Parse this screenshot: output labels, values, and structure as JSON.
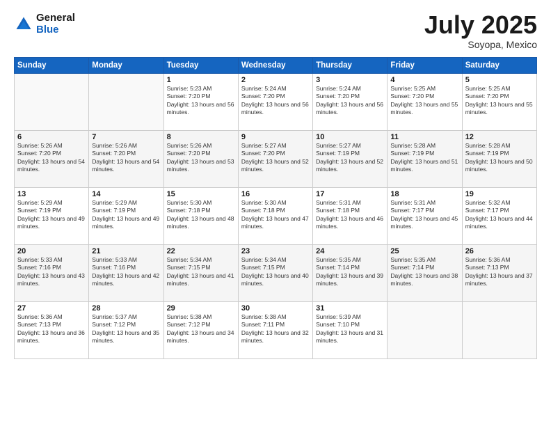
{
  "header": {
    "logo_general": "General",
    "logo_blue": "Blue",
    "month": "July 2025",
    "location": "Soyopa, Mexico"
  },
  "weekdays": [
    "Sunday",
    "Monday",
    "Tuesday",
    "Wednesday",
    "Thursday",
    "Friday",
    "Saturday"
  ],
  "weeks": [
    [
      {
        "day": "",
        "info": ""
      },
      {
        "day": "",
        "info": ""
      },
      {
        "day": "1",
        "info": "Sunrise: 5:23 AM\nSunset: 7:20 PM\nDaylight: 13 hours and 56 minutes."
      },
      {
        "day": "2",
        "info": "Sunrise: 5:24 AM\nSunset: 7:20 PM\nDaylight: 13 hours and 56 minutes."
      },
      {
        "day": "3",
        "info": "Sunrise: 5:24 AM\nSunset: 7:20 PM\nDaylight: 13 hours and 56 minutes."
      },
      {
        "day": "4",
        "info": "Sunrise: 5:25 AM\nSunset: 7:20 PM\nDaylight: 13 hours and 55 minutes."
      },
      {
        "day": "5",
        "info": "Sunrise: 5:25 AM\nSunset: 7:20 PM\nDaylight: 13 hours and 55 minutes."
      }
    ],
    [
      {
        "day": "6",
        "info": "Sunrise: 5:26 AM\nSunset: 7:20 PM\nDaylight: 13 hours and 54 minutes."
      },
      {
        "day": "7",
        "info": "Sunrise: 5:26 AM\nSunset: 7:20 PM\nDaylight: 13 hours and 54 minutes."
      },
      {
        "day": "8",
        "info": "Sunrise: 5:26 AM\nSunset: 7:20 PM\nDaylight: 13 hours and 53 minutes."
      },
      {
        "day": "9",
        "info": "Sunrise: 5:27 AM\nSunset: 7:20 PM\nDaylight: 13 hours and 52 minutes."
      },
      {
        "day": "10",
        "info": "Sunrise: 5:27 AM\nSunset: 7:19 PM\nDaylight: 13 hours and 52 minutes."
      },
      {
        "day": "11",
        "info": "Sunrise: 5:28 AM\nSunset: 7:19 PM\nDaylight: 13 hours and 51 minutes."
      },
      {
        "day": "12",
        "info": "Sunrise: 5:28 AM\nSunset: 7:19 PM\nDaylight: 13 hours and 50 minutes."
      }
    ],
    [
      {
        "day": "13",
        "info": "Sunrise: 5:29 AM\nSunset: 7:19 PM\nDaylight: 13 hours and 49 minutes."
      },
      {
        "day": "14",
        "info": "Sunrise: 5:29 AM\nSunset: 7:19 PM\nDaylight: 13 hours and 49 minutes."
      },
      {
        "day": "15",
        "info": "Sunrise: 5:30 AM\nSunset: 7:18 PM\nDaylight: 13 hours and 48 minutes."
      },
      {
        "day": "16",
        "info": "Sunrise: 5:30 AM\nSunset: 7:18 PM\nDaylight: 13 hours and 47 minutes."
      },
      {
        "day": "17",
        "info": "Sunrise: 5:31 AM\nSunset: 7:18 PM\nDaylight: 13 hours and 46 minutes."
      },
      {
        "day": "18",
        "info": "Sunrise: 5:31 AM\nSunset: 7:17 PM\nDaylight: 13 hours and 45 minutes."
      },
      {
        "day": "19",
        "info": "Sunrise: 5:32 AM\nSunset: 7:17 PM\nDaylight: 13 hours and 44 minutes."
      }
    ],
    [
      {
        "day": "20",
        "info": "Sunrise: 5:33 AM\nSunset: 7:16 PM\nDaylight: 13 hours and 43 minutes."
      },
      {
        "day": "21",
        "info": "Sunrise: 5:33 AM\nSunset: 7:16 PM\nDaylight: 13 hours and 42 minutes."
      },
      {
        "day": "22",
        "info": "Sunrise: 5:34 AM\nSunset: 7:15 PM\nDaylight: 13 hours and 41 minutes."
      },
      {
        "day": "23",
        "info": "Sunrise: 5:34 AM\nSunset: 7:15 PM\nDaylight: 13 hours and 40 minutes."
      },
      {
        "day": "24",
        "info": "Sunrise: 5:35 AM\nSunset: 7:14 PM\nDaylight: 13 hours and 39 minutes."
      },
      {
        "day": "25",
        "info": "Sunrise: 5:35 AM\nSunset: 7:14 PM\nDaylight: 13 hours and 38 minutes."
      },
      {
        "day": "26",
        "info": "Sunrise: 5:36 AM\nSunset: 7:13 PM\nDaylight: 13 hours and 37 minutes."
      }
    ],
    [
      {
        "day": "27",
        "info": "Sunrise: 5:36 AM\nSunset: 7:13 PM\nDaylight: 13 hours and 36 minutes."
      },
      {
        "day": "28",
        "info": "Sunrise: 5:37 AM\nSunset: 7:12 PM\nDaylight: 13 hours and 35 minutes."
      },
      {
        "day": "29",
        "info": "Sunrise: 5:38 AM\nSunset: 7:12 PM\nDaylight: 13 hours and 34 minutes."
      },
      {
        "day": "30",
        "info": "Sunrise: 5:38 AM\nSunset: 7:11 PM\nDaylight: 13 hours and 32 minutes."
      },
      {
        "day": "31",
        "info": "Sunrise: 5:39 AM\nSunset: 7:10 PM\nDaylight: 13 hours and 31 minutes."
      },
      {
        "day": "",
        "info": ""
      },
      {
        "day": "",
        "info": ""
      }
    ]
  ]
}
